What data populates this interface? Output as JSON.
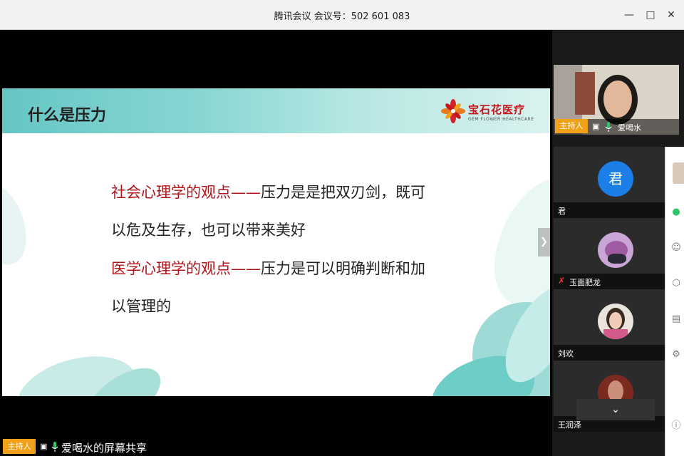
{
  "window": {
    "title": "腾讯会议 会议号：502 601 083",
    "controls": [
      "minimize-icon",
      "maximize-icon",
      "close-icon"
    ]
  },
  "slide": {
    "title": "什么是压力",
    "logo": {
      "main": "宝石花医疗",
      "sub": "GEM FLOWER HEALTHCARE"
    },
    "lines": [
      {
        "red": "社会心理学的观点——",
        "black": "压力是是把双刃剑，既可"
      },
      {
        "red": "",
        "black": "以危及生存，也可以带来美好"
      },
      {
        "red": "医学心理学的观点——",
        "black": "压力是可以明确判断和加"
      },
      {
        "red": "",
        "black": "以管理的"
      }
    ],
    "next_icon": "chevron-right-icon"
  },
  "share_bar": {
    "host_badge": "主持人",
    "label": "爱喝水的屏幕共享"
  },
  "host_tile": {
    "host_badge": "主持人",
    "name": "爱喝水"
  },
  "participants": [
    {
      "name": "君",
      "avatar_text": "君",
      "avatar_color": "#1c7fe8"
    },
    {
      "name": "玉面肥龙",
      "avatar_text": "",
      "avatar_color": "#d48bd0",
      "muted": true
    },
    {
      "name": "刘欢",
      "avatar_text": "",
      "avatar_color": "#e9e4dc"
    },
    {
      "name": "王润泽",
      "avatar_text": "",
      "avatar_color": "#7a2a1e"
    }
  ],
  "colors": {
    "host_badge": "#f0a019",
    "accent_red": "#b3141a",
    "teal": "#66c6c4"
  }
}
